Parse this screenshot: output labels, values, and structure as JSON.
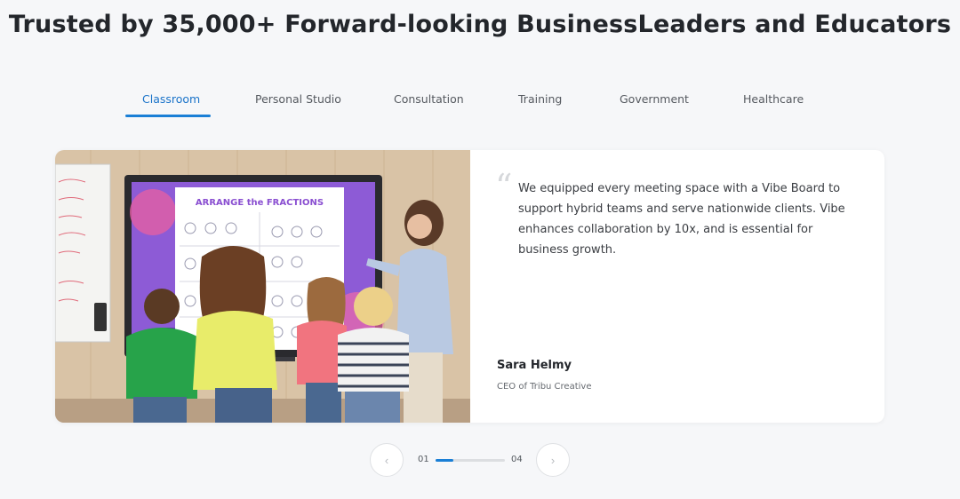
{
  "headline": "Trusted by 35,000+ Forward-looking BusinessLeaders and Educators",
  "tabs": [
    {
      "label": "Classroom",
      "active": true
    },
    {
      "label": "Personal Studio",
      "active": false
    },
    {
      "label": "Consultation",
      "active": false
    },
    {
      "label": "Training",
      "active": false
    },
    {
      "label": "Government",
      "active": false
    },
    {
      "label": "Healthcare",
      "active": false
    }
  ],
  "testimonial": {
    "quote": "We equipped every meeting space with a Vibe Board to support hybrid teams and serve nationwide clients. Vibe enhances collaboration by 10x, and is essential for business growth.",
    "author": "Sara Helmy",
    "role": "CEO of Tribu Creative",
    "image": {
      "board_title": "ARRANGE the FRACTIONS"
    }
  },
  "pager": {
    "current": "01",
    "total": "04",
    "progress": 0.25,
    "prev_icon": "chevron-left-icon",
    "next_icon": "chevron-right-icon"
  },
  "colors": {
    "accent": "#1a7fd6",
    "background": "#f6f7f9",
    "card": "#ffffff"
  }
}
